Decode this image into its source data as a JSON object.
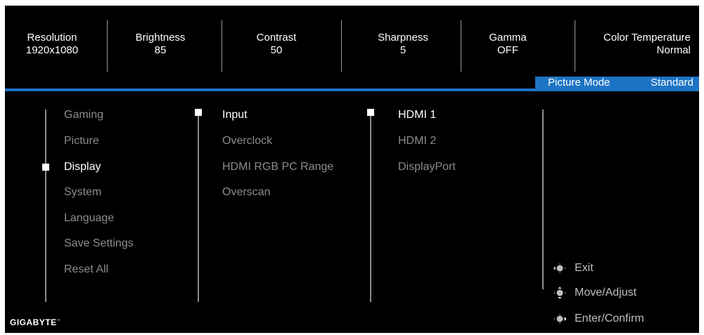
{
  "status_bar": {
    "resolution": {
      "label": "Resolution",
      "value": "1920x1080"
    },
    "brightness": {
      "label": "Brightness",
      "value": "85"
    },
    "contrast": {
      "label": "Contrast",
      "value": "50"
    },
    "sharpness": {
      "label": "Sharpness",
      "value": "5"
    },
    "gamma": {
      "label": "Gamma",
      "value": "OFF"
    },
    "color_temperature": {
      "label": "Color Temperature",
      "value": "Normal"
    }
  },
  "picture_mode": {
    "label": "Picture Mode",
    "value": "Standard"
  },
  "menu": {
    "main_items": [
      "Gaming",
      "Picture",
      "Display",
      "System",
      "Language",
      "Save Settings",
      "Reset All"
    ],
    "sub_items": [
      "Input",
      "Overclock",
      "HDMI RGB PC Range",
      "Overscan"
    ],
    "options": [
      "HDMI 1",
      "HDMI 2",
      "DisplayPort"
    ],
    "selected_main": "Display",
    "selected_sub": "Input",
    "selected_option": "HDMI 1"
  },
  "brand": {
    "logo_text": "GIGABYTE",
    "tm": "™"
  },
  "hints": {
    "exit": "Exit",
    "move_adjust": "Move/Adjust",
    "enter_confirm": "Enter/Confirm"
  },
  "colors": {
    "accent": "#1e74c4",
    "background": "#000000",
    "inactive_text": "#8c8c8c",
    "active_text": "#ffffff"
  },
  "icons": {
    "joystick": "joystick-icon",
    "selection": "selection-marker-icon"
  }
}
